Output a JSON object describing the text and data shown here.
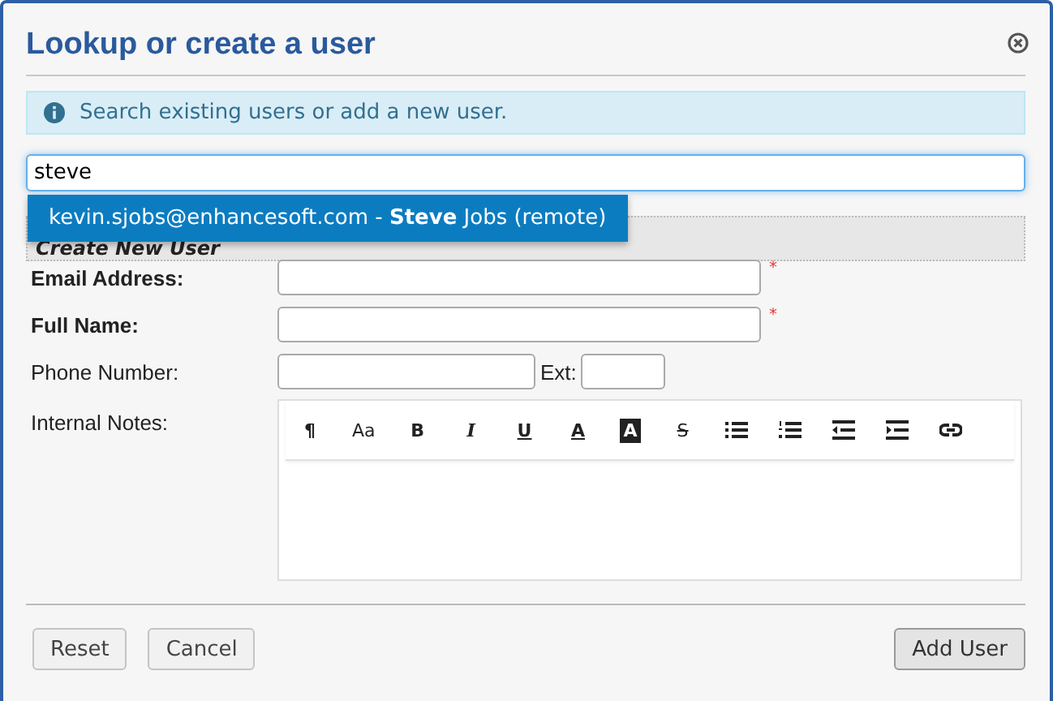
{
  "dialog": {
    "title": "Lookup or create a user"
  },
  "info": {
    "text": "Search existing users or add a new user."
  },
  "search": {
    "value": "steve"
  },
  "suggestions": [
    {
      "text": "kevin.sjobs@enhancesoft.com - **Steve** Jobs (remote)",
      "selected": true
    }
  ],
  "section": {
    "title": "Create New User"
  },
  "fields": [
    {
      "kind": "text",
      "label": "Email Address:",
      "required": true
    },
    {
      "kind": "text",
      "label": "Full Name:",
      "required": true
    },
    {
      "kind": "phone",
      "label": "Phone Number:",
      "required": false,
      "ext_label": "Ext:"
    },
    {
      "kind": "editor",
      "label": "Internal Notes:",
      "required": false
    }
  ],
  "required_mark": "*",
  "toolbar": [
    {
      "kind": "glyph",
      "text": "¶"
    },
    {
      "kind": "glyph",
      "text": "Aa"
    },
    {
      "kind": "glyph",
      "text": "B"
    },
    {
      "kind": "glyph",
      "text": "I"
    },
    {
      "kind": "glyph",
      "text": "U"
    },
    {
      "kind": "glyph",
      "text": "A"
    },
    {
      "kind": "glyph",
      "text": "A"
    },
    {
      "kind": "glyph",
      "text": "S"
    },
    {
      "kind": "bullet-list"
    },
    {
      "kind": "numbered-list"
    },
    {
      "kind": "outdent"
    },
    {
      "kind": "indent"
    },
    {
      "kind": "link"
    }
  ],
  "buttons": [
    {
      "label": "Reset"
    },
    {
      "label": "Cancel"
    },
    {
      "label": "Add User"
    }
  ]
}
